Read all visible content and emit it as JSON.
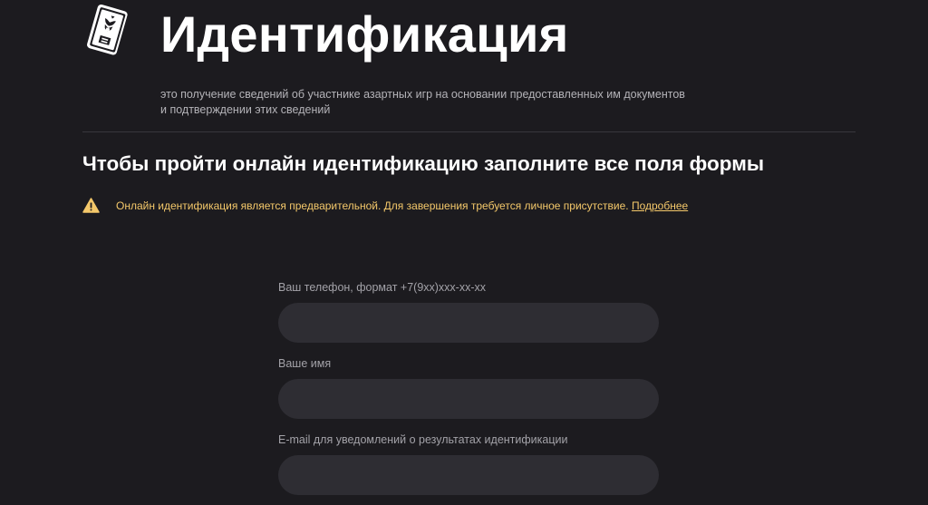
{
  "header": {
    "title": "Идентификация",
    "subtitle_line1": "это получение сведений об участнике азартных игр на основании предоставленных им документов",
    "subtitle_line2": "и подтверждении этих сведений",
    "icon": "passport-icon"
  },
  "section": {
    "heading": "Чтобы пройти онлайн идентификацию заполните все поля формы"
  },
  "notice": {
    "icon": "warning-icon",
    "text": "Онлайн идентификация является предварительной. Для завершения требуется личное присутствие. ",
    "link_label": "Подробнее",
    "color": "#f4c86a"
  },
  "form": {
    "phone": {
      "label": "Ваш телефон, формат +7(9xx)xxx-xx-xx",
      "value": ""
    },
    "name": {
      "label": "Ваше имя",
      "value": ""
    },
    "email": {
      "label": "E-mail для уведомлений о результатах идентификации",
      "value": ""
    }
  },
  "colors": {
    "background": "#1c1b1f",
    "input_background": "#2e2d33",
    "warning": "#f4c86a"
  }
}
